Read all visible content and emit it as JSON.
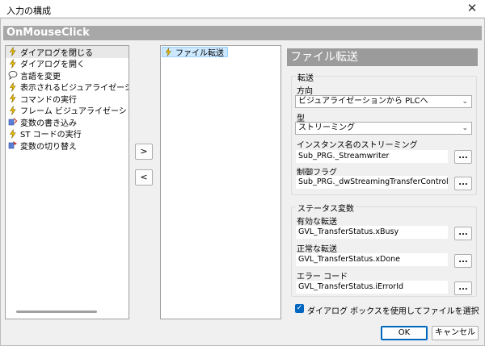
{
  "window": {
    "title": "入力の構成",
    "close_symbol": "✕"
  },
  "event_header": "OnMouseClick",
  "actions": [
    {
      "label": "ダイアログを閉じる",
      "icon": "lightning-icon"
    },
    {
      "label": "ダイアログを開く",
      "icon": "lightning-icon"
    },
    {
      "label": "言語を変更",
      "icon": "speech-bubble-icon"
    },
    {
      "label": "表示されるビジュアライゼーションを変",
      "icon": "lightning-icon"
    },
    {
      "label": "コマンドの実行",
      "icon": "lightning-icon"
    },
    {
      "label": "フレーム ビジュアライゼーションの切り",
      "icon": "lightning-icon"
    },
    {
      "label": "変数の書き込み",
      "icon": "variable-write-icon"
    },
    {
      "label": "ST コードの実行",
      "icon": "lightning-icon"
    },
    {
      "label": "変数の切り替え",
      "icon": "variable-toggle-icon"
    }
  ],
  "buttons": {
    "add": ">",
    "remove": "<",
    "ok": "OK",
    "cancel": "キャンセル",
    "browse": "..."
  },
  "assigned": [
    {
      "label": "ファイル転送",
      "icon": "lightning-icon"
    }
  ],
  "panel": {
    "title": "ファイル転送",
    "transfer": {
      "legend": "転送",
      "direction_label": "方向",
      "direction_value": "ビジュアライゼーションから PLCへ",
      "type_label": "型",
      "type_value": "ストリーミング",
      "instance_label": "インスタンス名のストリーミング",
      "instance_value": "Sub_PRG._Streamwriter",
      "flags_label": "制御フラグ",
      "flags_value": "Sub_PRG._dwStreamingTransferControlFlags"
    },
    "status": {
      "legend": "ステータス変数",
      "valid_label": "有効な転送",
      "valid_value": "GVL_TransferStatus.xBusy",
      "normal_label": "正常な転送",
      "normal_value": "GVL_TransferStatus.xDone",
      "error_label": "エラー コード",
      "error_value": "GVL_TransferStatus.iErrorId"
    },
    "dialog_checkbox": {
      "label": "ダイアログ ボックスを使用してファイルを選択",
      "checked": true
    }
  }
}
